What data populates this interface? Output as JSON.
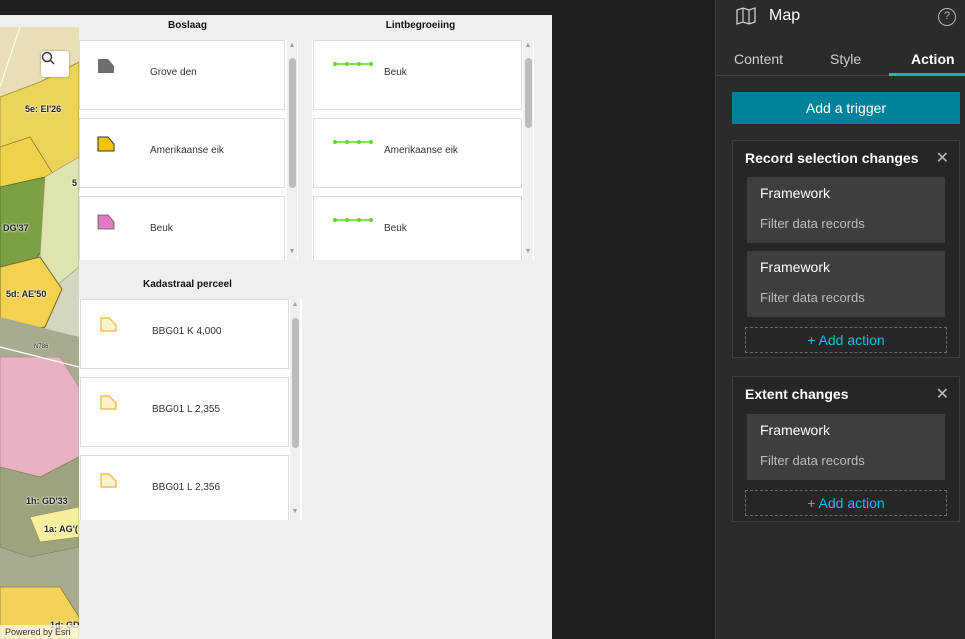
{
  "map": {
    "labels": [
      "5e: EI'26",
      "5",
      "DG'37",
      "5d: AE'50",
      "N786",
      "1h: GD'33",
      "1a: AG'(",
      "1d: GD"
    ],
    "attribution": "Powered by Esri",
    "search_icon": "search-icon"
  },
  "legends": {
    "boslaag": {
      "title": "Boslaag",
      "items": [
        {
          "label": "Grove den",
          "color": "#6e6e6e"
        },
        {
          "label": "Amerikaanse eik",
          "color": "#f5c400"
        },
        {
          "label": "Beuk",
          "color": "#e07bc4"
        }
      ]
    },
    "lintbegroeiing": {
      "title": "Lintbegroeiing",
      "items": [
        {
          "label": "Beuk",
          "color": "#5bdc1a"
        },
        {
          "label": "Amerikaanse eik",
          "color": "#5bdc1a"
        },
        {
          "label": "Beuk",
          "color": "#5bdc1a"
        }
      ]
    },
    "kadastraal": {
      "title": "Kadastraal perceel",
      "items": [
        {
          "label": "BBG01 K 4,000",
          "color": "#f2b233"
        },
        {
          "label": "BBG01 L 2,355",
          "color": "#f2b233"
        },
        {
          "label": "BBG01 L 2,356",
          "color": "#f2b233"
        }
      ]
    }
  },
  "side": {
    "title": "Map",
    "icon": "map-icon",
    "help": "?",
    "tabs": [
      {
        "label": "Content",
        "active": false
      },
      {
        "label": "Style",
        "active": false
      },
      {
        "label": "Action",
        "active": true
      }
    ],
    "add_trigger": "Add a trigger",
    "triggers": [
      {
        "title": "Record selection changes",
        "actions": [
          {
            "title": "Framework",
            "subtitle": "Filter data records"
          },
          {
            "title": "Framework",
            "subtitle": "Filter data records"
          }
        ],
        "add_action": "+ Add action"
      },
      {
        "title": "Extent changes",
        "actions": [
          {
            "title": "Framework",
            "subtitle": "Filter data records"
          }
        ],
        "add_action": "+ Add action"
      }
    ],
    "accent": "#07b4d6",
    "button_color": "#00819c"
  }
}
